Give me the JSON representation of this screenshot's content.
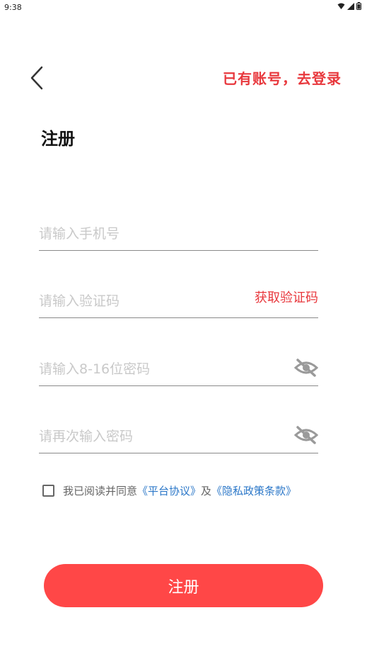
{
  "status_bar": {
    "time": "9:38",
    "icons": [
      "wifi-icon",
      "signal-icon",
      "battery-icon"
    ]
  },
  "header": {
    "back_icon": "chevron-left-icon",
    "login_link": "已有账号，去登录"
  },
  "title": "注册",
  "form": {
    "phone_placeholder": "请输入手机号",
    "code_placeholder": "请输入验证码",
    "get_code_label": "获取验证码",
    "password_placeholder": "请输入8-16位密码",
    "confirm_placeholder": "请再次输入密码",
    "eye_icon": "eye-off-icon"
  },
  "agreement": {
    "checked": false,
    "prefix": "我已阅读并同意",
    "platform_link": "《平台协议》",
    "connector": "及",
    "privacy_link": "《隐私政策条款》"
  },
  "submit_label": "注册",
  "colors": {
    "accent_red": "#e8383d",
    "button_red": "#ff4747",
    "link_blue": "#2b77c8",
    "placeholder_gray": "#c9c9c9"
  }
}
